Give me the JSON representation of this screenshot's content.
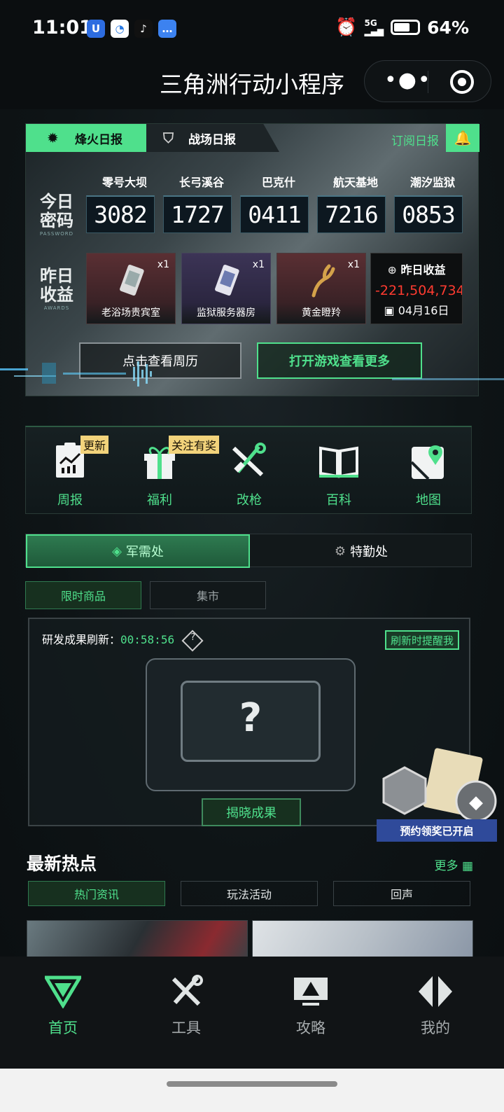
{
  "status": {
    "time": "11:01",
    "network": "5G",
    "battery": "64%",
    "battery_level": 0.64
  },
  "titlebar": {
    "title": "三角洲行动小程序"
  },
  "report": {
    "tabs": [
      "烽火日报",
      "战场日报"
    ],
    "subscribe": "订阅日报",
    "password_label": [
      "今日",
      "密码"
    ],
    "password_sub": "PASSWORD",
    "awards_label": [
      "昨日",
      "收益"
    ],
    "awards_sub": "AWARDS",
    "maps": [
      {
        "name": "零号大坝",
        "code": "3082"
      },
      {
        "name": "长弓溪谷",
        "code": "1727"
      },
      {
        "name": "巴克什",
        "code": "0411"
      },
      {
        "name": "航天基地",
        "code": "7216"
      },
      {
        "name": "潮汐监狱",
        "code": "0853"
      }
    ],
    "items": [
      {
        "label": "老浴场贵宾室",
        "qty": "x1"
      },
      {
        "label": "监狱服务器房",
        "qty": "x1"
      },
      {
        "label": "黄金瞪羚",
        "qty": "x1"
      }
    ],
    "earnings": {
      "title": "昨日收益",
      "value": "-221,504,734",
      "date": "04月16日"
    },
    "btn_calendar": "点击查看周历",
    "btn_open": "打开游戏查看更多"
  },
  "quicknav": [
    {
      "label": "周报",
      "badge": "更新"
    },
    {
      "label": "福利",
      "badge": "关注有奖"
    },
    {
      "label": "改枪",
      "badge": ""
    },
    {
      "label": "百科",
      "badge": ""
    },
    {
      "label": "地图",
      "badge": ""
    }
  ],
  "segment": {
    "a": "军需处",
    "b": "特勤处"
  },
  "subtabs": [
    "限时商品",
    "集市"
  ],
  "research": {
    "title": "研发成果刷新：",
    "countdown": "00:58:56",
    "remind": "刷新时提醒我",
    "reveal": "揭晓成果",
    "placeholder": "?"
  },
  "promo": {
    "text": "预约领奖已开启"
  },
  "news": {
    "heading": "最新热点",
    "more": "更多",
    "tabs": [
      "热门资讯",
      "玩法活动",
      "回声"
    ]
  },
  "bottomnav": [
    {
      "label": "首页"
    },
    {
      "label": "工具"
    },
    {
      "label": "攻略"
    },
    {
      "label": "我的"
    }
  ],
  "colors": {
    "accent": "#4fe08c",
    "negative": "#ff3b30",
    "badge": "#f2d37b"
  }
}
